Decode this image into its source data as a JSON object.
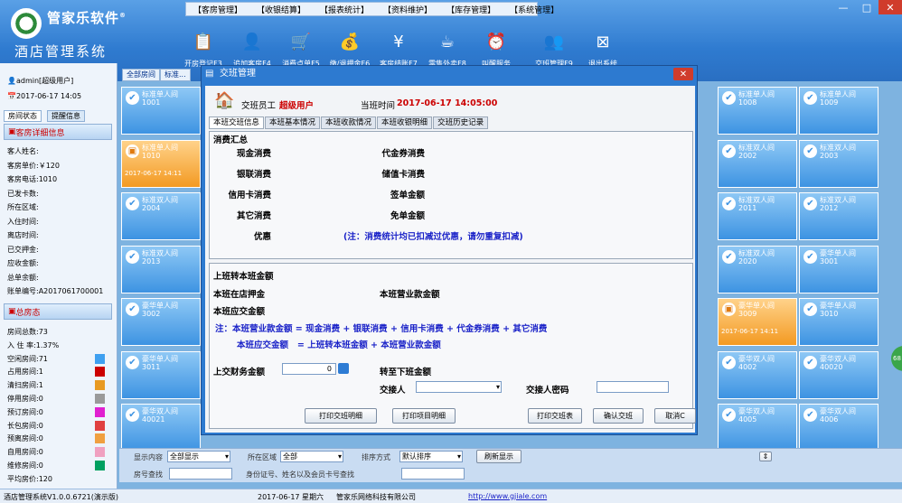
{
  "brand": "管家乐软件",
  "brand_mark": "®",
  "app_name": "酒店管理系统",
  "menu": [
    "【客房管理】",
    "【收银结算】",
    "【报表统计】",
    "【资料维护】",
    "【库存管理】",
    "【系统管理】"
  ],
  "window_buttons": [
    "—",
    "□",
    "✕"
  ],
  "toolbar": [
    {
      "label": "开房登记F3",
      "icon": "clipboard-icon",
      "glyph": "📋"
    },
    {
      "label": "追加客房F4",
      "icon": "person-icon",
      "glyph": "👤"
    },
    {
      "label": "消费点单F5",
      "icon": "cart-icon",
      "glyph": "🛒"
    },
    {
      "label": "缴/退押金F6",
      "icon": "coins-icon",
      "glyph": "💰"
    },
    {
      "label": "客房结账F7",
      "icon": "yen-icon",
      "glyph": "¥"
    },
    {
      "label": "零售外卖F8",
      "icon": "coffee-icon",
      "glyph": "☕"
    },
    {
      "label": "叫醒服务",
      "icon": "alarm-clock-icon",
      "glyph": "⏰"
    },
    {
      "label": "交班管理F9",
      "icon": "users-icon",
      "glyph": "👥"
    },
    {
      "label": "退出系统",
      "icon": "exit-icon",
      "glyph": "⊠"
    }
  ],
  "user": {
    "name": "admin[超级用户]",
    "date": "2017-06-17 14:05"
  },
  "left_tabs": [
    "房间状态",
    "提醒信息"
  ],
  "room_detail": {
    "header": "客房详细信息",
    "fields": [
      "客人姓名:",
      "客房单价:￥120",
      "客房电话:1010",
      "已发卡数:",
      "所在区域:",
      "入住时间:",
      "离店时间:",
      "已交押金:",
      "应收金额:",
      "总单余额:",
      "账单编号:A2017061700001"
    ]
  },
  "house_status": {
    "header": "总房态",
    "fields": [
      "房间总数:73",
      "入 住 率:1.37%",
      "空闲房间:71",
      "占用房间:1",
      "清扫房间:1",
      "停用房间:0",
      "预订房间:0",
      "长包房间:0",
      "预离房间:0",
      "自用房间:0",
      "维修房间:0",
      "平均房价:120"
    ],
    "colors": [
      "#3fa0f0",
      "#cc0000",
      "#e89a22",
      "#9a9a9a",
      "#e020d0",
      "#e04040",
      "#f0a040",
      "#f0a0c0",
      "#00a060"
    ]
  },
  "room_tabs": [
    "全部房间",
    "标准..."
  ],
  "rooms": [
    {
      "type": "标准单人间",
      "no": "1001",
      "date": "",
      "occ": false
    },
    {
      "type": "标准单人间",
      "no": "1010",
      "date": "2017-06-17 14:11",
      "occ": true
    },
    {
      "type": "标准双人间",
      "no": "2004",
      "date": "",
      "occ": false
    },
    {
      "type": "标准双人间",
      "no": "2013",
      "date": "",
      "occ": false
    },
    {
      "type": "豪华单人间",
      "no": "3002",
      "date": "",
      "occ": false
    },
    {
      "type": "豪华单人间",
      "no": "3011",
      "date": "",
      "occ": false
    },
    {
      "type": "豪华双人间",
      "no": "40021",
      "date": "",
      "occ": false
    },
    {
      "type": "标准单人间",
      "no": "1008",
      "date": "",
      "occ": false
    },
    {
      "type": "标准单人间",
      "no": "1009",
      "date": "",
      "occ": false
    },
    {
      "type": "标准双人间",
      "no": "2002",
      "date": "",
      "occ": false
    },
    {
      "type": "标准双人间",
      "no": "2003",
      "date": "",
      "occ": false
    },
    {
      "type": "标准双人间",
      "no": "2011",
      "date": "",
      "occ": false
    },
    {
      "type": "标准双人间",
      "no": "2012",
      "date": "",
      "occ": false
    },
    {
      "type": "标准双人间",
      "no": "2020",
      "date": "",
      "occ": false
    },
    {
      "type": "豪华单人间",
      "no": "3001",
      "date": "",
      "occ": false
    },
    {
      "type": "豪华单人间",
      "no": "3009",
      "date": "2017-06-17 14:11",
      "occ": true
    },
    {
      "type": "豪华单人间",
      "no": "3010",
      "date": "",
      "occ": false
    },
    {
      "type": "豪华双人间",
      "no": "4002",
      "date": "",
      "occ": false
    },
    {
      "type": "豪华双人间",
      "no": "40020",
      "date": "",
      "occ": false
    },
    {
      "type": "豪华双人间",
      "no": "4005",
      "date": "",
      "occ": false
    },
    {
      "type": "豪华双人间",
      "no": "4006",
      "date": "",
      "occ": false
    }
  ],
  "bottom": {
    "show_label": "显示内容",
    "show_value": "全部显示",
    "area_label": "所在区域",
    "area_value": "全部",
    "sort_label": "排序方式",
    "sort_value": "默认排序",
    "refresh": "刷新显示",
    "room_search": "房号查找",
    "id_search": "身份证号、姓名以及会员卡号查找"
  },
  "status": {
    "version": "酒店管理系统V1.0.0.6721(演示版)",
    "date": "2017-06-17 星期六",
    "company": "管家乐网络科技有限公司",
    "url": "http://www.gjiale.com"
  },
  "modal": {
    "title": "交班管理",
    "staff_label": "交班员工",
    "staff_value": "超级用户",
    "time_label": "当班时间",
    "time_value": "2017-06-17 14:05:00",
    "tabs": [
      "本班交班信息",
      "本班基本情况",
      "本班收款情况",
      "本班收银明细",
      "交班历史记录"
    ],
    "summary_title": "消费汇总",
    "left_items": [
      "现金消费",
      "银联消费",
      "信用卡消费",
      "其它消费",
      "优惠"
    ],
    "right_items": [
      "代金券消费",
      "储值卡消费",
      "签单金额",
      "免单金额"
    ],
    "note1": "(注：消费统计均已扣减过优惠，请勿重复扣减)",
    "carry": "上班转本班金额",
    "deposit": "本班在店押金",
    "revenue": "本班营业款金额",
    "due": "本班应交金额",
    "formula1": "注：本班营业款金额 = 现金消费 + 银联消费 + 信用卡消费 + 代金券消费 + 其它消费",
    "formula2": "本班应交金额   = 上班转本班金额 + 本班营业款金额",
    "hand_label": "上交财务金额",
    "hand_value": "0",
    "next_label": "转至下班金额",
    "receiver_label": "交接人",
    "pwd_label": "交接人密码",
    "buttons": [
      "打印交班明细",
      "打印项目明细",
      "打印交班表",
      "确认交班",
      "取消C"
    ]
  },
  "side_badge": "68"
}
